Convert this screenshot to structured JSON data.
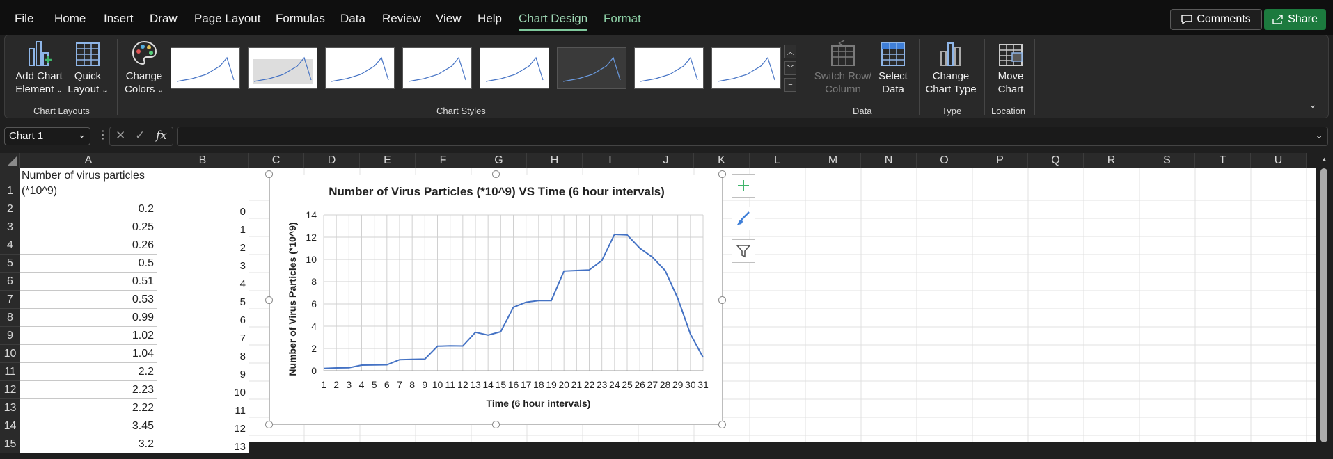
{
  "menu": {
    "items": [
      "File",
      "Home",
      "Insert",
      "Draw",
      "Page Layout",
      "Formulas",
      "Data",
      "Review",
      "View",
      "Help",
      "Chart Design",
      "Format"
    ],
    "active": "Chart Design",
    "comments_label": "Comments",
    "share_label": "Share"
  },
  "ribbon": {
    "add_chart_element": [
      "Add Chart",
      "Element"
    ],
    "quick_layout": [
      "Quick",
      "Layout"
    ],
    "change_colors": [
      "Change",
      "Colors"
    ],
    "switch_row_column": [
      "Switch Row/",
      "Column"
    ],
    "select_data": [
      "Select",
      "Data"
    ],
    "change_chart_type": [
      "Change",
      "Chart Type"
    ],
    "move_chart": [
      "Move",
      "Chart"
    ],
    "groups": {
      "chart_layouts": "Chart Layouts",
      "chart_styles": "Chart Styles",
      "data": "Data",
      "type": "Type",
      "location": "Location"
    }
  },
  "formula_bar": {
    "name_box": "Chart 1",
    "fx_label": "fx",
    "formula": ""
  },
  "columns": [
    "A",
    "B",
    "C",
    "D",
    "E",
    "F",
    "G",
    "H",
    "I",
    "J",
    "K",
    "L",
    "M",
    "N",
    "O",
    "P",
    "Q",
    "R",
    "S",
    "T",
    "U"
  ],
  "rows": [
    {
      "n": "1",
      "a": "Number of virus particles (*10^9)",
      "b": ""
    },
    {
      "n": "2",
      "a": "0.2",
      "b": "0"
    },
    {
      "n": "3",
      "a": "0.25",
      "b": "1"
    },
    {
      "n": "4",
      "a": "0.26",
      "b": "2"
    },
    {
      "n": "5",
      "a": "0.5",
      "b": "3"
    },
    {
      "n": "6",
      "a": "0.51",
      "b": "4"
    },
    {
      "n": "7",
      "a": "0.53",
      "b": "5"
    },
    {
      "n": "8",
      "a": "0.99",
      "b": "6"
    },
    {
      "n": "9",
      "a": "1.02",
      "b": "7"
    },
    {
      "n": "10",
      "a": "1.04",
      "b": "8"
    },
    {
      "n": "11",
      "a": "2.2",
      "b": "9"
    },
    {
      "n": "12",
      "a": "2.23",
      "b": "10"
    },
    {
      "n": "13",
      "a": "2.22",
      "b": "11"
    },
    {
      "n": "14",
      "a": "3.45",
      "b": "12"
    },
    {
      "n": "15",
      "a": "3.2",
      "b": "13"
    }
  ],
  "chart_data": {
    "type": "line",
    "title": "Number of Virus Particles (*10^9) VS Time (6 hour intervals)",
    "xlabel": "Time (6 hour intervals)",
    "ylabel": "Number of Virus Particles (*10^9)",
    "categories": [
      "1",
      "2",
      "3",
      "4",
      "5",
      "6",
      "7",
      "8",
      "9",
      "10",
      "11",
      "12",
      "13",
      "14",
      "15",
      "16",
      "17",
      "18",
      "19",
      "20",
      "21",
      "22",
      "23",
      "24",
      "25",
      "26",
      "27",
      "28",
      "29",
      "30",
      "31"
    ],
    "values": [
      0.2,
      0.25,
      0.26,
      0.5,
      0.51,
      0.53,
      0.99,
      1.02,
      1.04,
      2.2,
      2.23,
      2.22,
      3.45,
      3.2,
      3.5,
      5.7,
      6.15,
      6.3,
      6.3,
      8.95,
      9.0,
      9.05,
      9.9,
      12.25,
      12.2,
      11.0,
      10.2,
      9.0,
      6.5,
      3.3,
      1.2
    ],
    "ylim": [
      0,
      14
    ],
    "yticks": [
      "0",
      "2",
      "4",
      "6",
      "8",
      "10",
      "12",
      "14"
    ],
    "grid": true,
    "legend": "none",
    "line_color": "#4472c4"
  }
}
